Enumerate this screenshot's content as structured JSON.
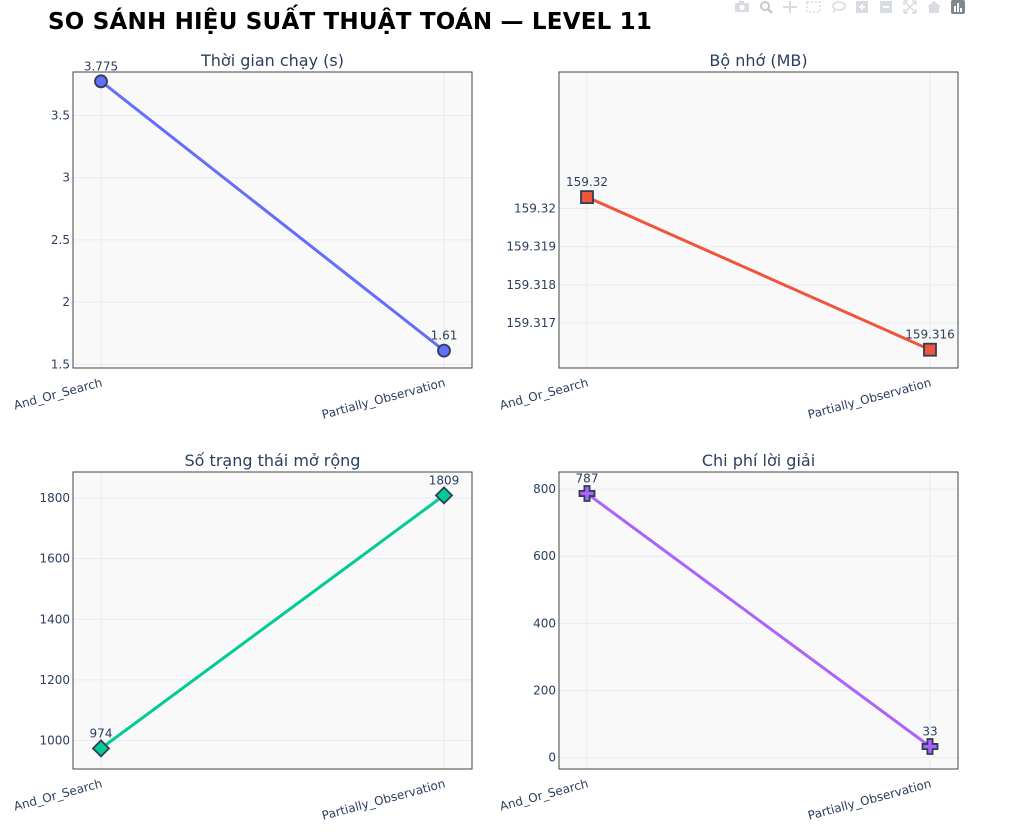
{
  "title": "SO SÁNH HIỆU SUẤT THUẬT TOÁN — LEVEL 11",
  "modebar": {
    "icons": [
      "camera-icon",
      "zoom-icon",
      "pan-icon",
      "box-select-icon",
      "lasso-icon",
      "zoom-in-icon",
      "zoom-out-icon",
      "autoscale-icon",
      "home-icon",
      "plotly-logo-icon"
    ]
  },
  "chart_data": [
    {
      "type": "line",
      "title": "Thời gian chạy (s)",
      "categories": [
        "And_Or_Search",
        "Partially_Observation"
      ],
      "values": [
        3.775,
        1.61
      ],
      "data_labels": [
        "3.775",
        "1.61"
      ],
      "ylim": [
        1.47,
        3.85
      ],
      "yticks": [
        1.5,
        2,
        2.5,
        3,
        3.5
      ],
      "ytick_labels": [
        "1.5",
        "2",
        "2.5",
        "3",
        "3.5"
      ],
      "color": "#636efa",
      "marker": "circle",
      "grid": true
    },
    {
      "type": "line",
      "title": "Bộ nhớ (MB)",
      "categories": [
        "And_Or_Search",
        "Partially_Observation"
      ],
      "values": [
        159.3203,
        159.3163
      ],
      "data_labels": [
        "159.32",
        "159.316"
      ],
      "ylim": [
        159.31582,
        159.32358
      ],
      "yticks": [
        159.317,
        159.318,
        159.319,
        159.32
      ],
      "ytick_labels": [
        "159.317",
        "159.318",
        "159.319",
        "159.32"
      ],
      "color": "#ef553b",
      "marker": "square",
      "grid": true
    },
    {
      "type": "line",
      "title": "Số trạng thái mở rộng",
      "categories": [
        "And_Or_Search",
        "Partially_Observation"
      ],
      "values": [
        974,
        1809
      ],
      "data_labels": [
        "974",
        "1809"
      ],
      "ylim": [
        906,
        1886
      ],
      "yticks": [
        1000,
        1200,
        1400,
        1600,
        1800
      ],
      "ytick_labels": [
        "1000",
        "1200",
        "1400",
        "1600",
        "1800"
      ],
      "color": "#00cc96",
      "marker": "diamond",
      "grid": true
    },
    {
      "type": "line",
      "title": "Chi phí lời giải",
      "categories": [
        "And_Or_Search",
        "Partially_Observation"
      ],
      "values": [
        787,
        33
      ],
      "data_labels": [
        "787",
        "33"
      ],
      "ylim": [
        -34,
        851
      ],
      "yticks": [
        0,
        200,
        400,
        600,
        800
      ],
      "ytick_labels": [
        "0",
        "200",
        "400",
        "600",
        "800"
      ],
      "color": "#ab63fa",
      "marker": "cross",
      "grid": true
    }
  ]
}
